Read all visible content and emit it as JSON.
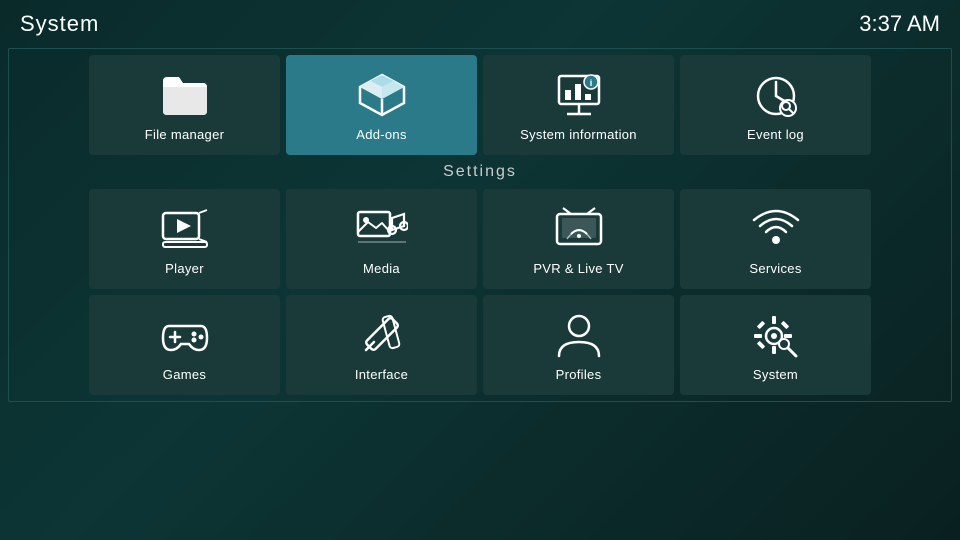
{
  "header": {
    "title": "System",
    "clock": "3:37 AM"
  },
  "topRow": {
    "items": [
      {
        "id": "file-manager",
        "label": "File manager",
        "icon": "folder"
      },
      {
        "id": "add-ons",
        "label": "Add-ons",
        "icon": "addons",
        "active": true
      },
      {
        "id": "system-information",
        "label": "System information",
        "icon": "system-info"
      },
      {
        "id": "event-log",
        "label": "Event log",
        "icon": "event-log"
      }
    ]
  },
  "settings": {
    "label": "Settings",
    "items": [
      {
        "id": "player",
        "label": "Player",
        "icon": "player"
      },
      {
        "id": "media",
        "label": "Media",
        "icon": "media"
      },
      {
        "id": "pvr-live-tv",
        "label": "PVR & Live TV",
        "icon": "pvr"
      },
      {
        "id": "services",
        "label": "Services",
        "icon": "services"
      },
      {
        "id": "games",
        "label": "Games",
        "icon": "games"
      },
      {
        "id": "interface",
        "label": "Interface",
        "icon": "interface"
      },
      {
        "id": "profiles",
        "label": "Profiles",
        "icon": "profiles"
      },
      {
        "id": "system",
        "label": "System",
        "icon": "system-settings"
      }
    ]
  }
}
